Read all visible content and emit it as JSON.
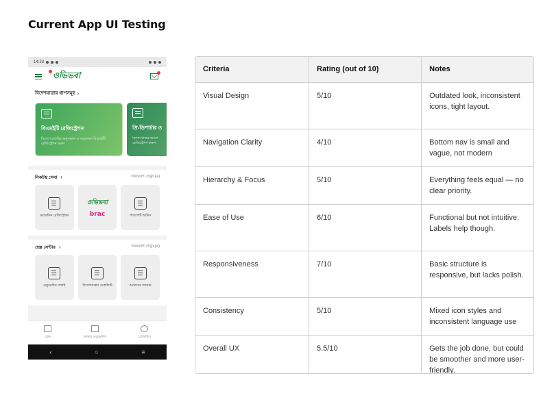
{
  "page_title": "Current App UI Testing",
  "phone": {
    "status_time": "14:23",
    "logo_text": "ওভিভবা",
    "steps_title": "বিদেশযাত্রার ধাপসমূহ",
    "cards": [
      {
        "title": "বিএমইটি রেজিস্ট্রেশন",
        "subtitle": "বিদেশে চাকরির অনুসন্ধান ও আবেদনে বিএমইটি রেজিস্ট্রেশন করুন"
      },
      {
        "title": "প্রি-ডিপার্চার ও",
        "subtitle": "বিদেশ যাবার আগে রেজিস্ট্রেশন করুন"
      }
    ],
    "nearby": {
      "title": "নিকটস্থ সেবা",
      "see_all": "সবগুলো দেখুন (৬)",
      "tiles": [
        {
          "label": "ভ্যাকসিন রেজিস্ট্রেশন",
          "icon": "vaccine-icon"
        },
        {
          "label": "brac",
          "logo": "ওভিভবা",
          "icon": "brac-logo"
        },
        {
          "label": "পাসপোর্ট অফিস",
          "icon": "passport-icon"
        }
      ]
    },
    "help": {
      "title": "হেল্প সেন্টার",
      "see_all": "সবগুলো দেখুন (৫)",
      "tiles": [
        {
          "label": "ডকুমেন্টস যাচাই",
          "icon": "document-icon"
        },
        {
          "label": "বিদেশযাত্রার চেকলিস্ট",
          "icon": "checklist-icon"
        },
        {
          "label": "আমাদের জানান",
          "icon": "feedback-icon"
        }
      ]
    },
    "bottom_nav": [
      {
        "label": "হোম",
        "icon": "home-icon"
      },
      {
        "label": "আমার ডকুমেন্টস",
        "icon": "folder-icon"
      },
      {
        "label": "প্রোফাইল",
        "icon": "user-icon"
      }
    ],
    "system_nav": {
      "back": "‹",
      "home": "○",
      "menu": "≡"
    }
  },
  "table": {
    "headers": [
      "Criteria",
      "Rating (out of 10)",
      "Notes"
    ],
    "rows": [
      {
        "criteria": "Visual Design",
        "rating": "5/10",
        "notes": "Outdated look, inconsistent icons, tight layout."
      },
      {
        "criteria": "Navigation Clarity",
        "rating": "4/10",
        "notes": "Bottom nav is small and vague, not modern"
      },
      {
        "criteria": "Hierarchy & Focus",
        "rating": "5/10",
        "notes": "Everything feels equal — no clear priority."
      },
      {
        "criteria": "Ease of Use",
        "rating": "6/10",
        "notes": "Functional but not intuitive. Labels help though."
      },
      {
        "criteria": "Responsiveness",
        "rating": "7/10",
        "notes": "Basic structure is responsive, but lacks polish."
      },
      {
        "criteria": "Consistency",
        "rating": "5/10",
        "notes": "Mixed icon styles and inconsistent language use"
      },
      {
        "criteria": "Overall UX",
        "rating": "5.5/10",
        "notes": "Gets the job done, but could be smoother and more user-friendly."
      }
    ]
  }
}
